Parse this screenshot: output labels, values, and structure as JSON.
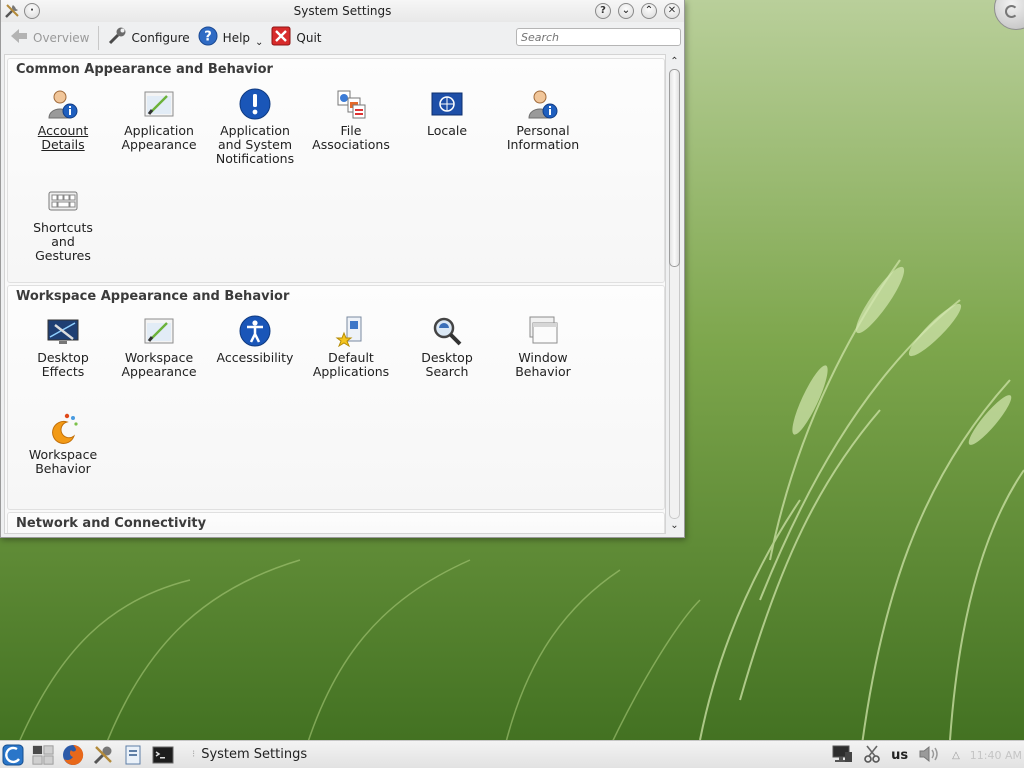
{
  "window": {
    "title": "System Settings"
  },
  "toolbar": {
    "overview": "Overview",
    "configure": "Configure",
    "help": "Help",
    "quit": "Quit",
    "search_placeholder": "Search"
  },
  "sections": [
    {
      "title": "Common Appearance and Behavior",
      "items": [
        {
          "label": "Account\nDetails",
          "icon": "user-info-icon"
        },
        {
          "label": "Application\nAppearance",
          "icon": "paintbrush-icon"
        },
        {
          "label": "Application\nand System\nNotifications",
          "icon": "exclamation-icon"
        },
        {
          "label": "File\nAssociations",
          "icon": "file-types-icon"
        },
        {
          "label": "Locale",
          "icon": "un-flag-icon"
        },
        {
          "label": "Personal\nInformation",
          "icon": "user-info-icon"
        },
        {
          "label": "Shortcuts\nand\nGestures",
          "icon": "keyboard-icon"
        }
      ]
    },
    {
      "title": "Workspace Appearance and Behavior",
      "items": [
        {
          "label": "Desktop\nEffects",
          "icon": "desktop-effects-icon"
        },
        {
          "label": "Workspace\nAppearance",
          "icon": "paintbrush-icon"
        },
        {
          "label": "Accessibility",
          "icon": "accessibility-icon"
        },
        {
          "label": "Default\nApplications",
          "icon": "default-apps-icon"
        },
        {
          "label": "Desktop\nSearch",
          "icon": "magnifier-icon"
        },
        {
          "label": "Window\nBehavior",
          "icon": "windows-icon"
        },
        {
          "label": "Workspace\nBehavior",
          "icon": "plasma-icon"
        }
      ]
    },
    {
      "title": "Network and Connectivity",
      "items": []
    }
  ],
  "taskbar": {
    "active_task": "System Settings",
    "keyboard_layout": "us",
    "clock": "11:40 AM"
  }
}
